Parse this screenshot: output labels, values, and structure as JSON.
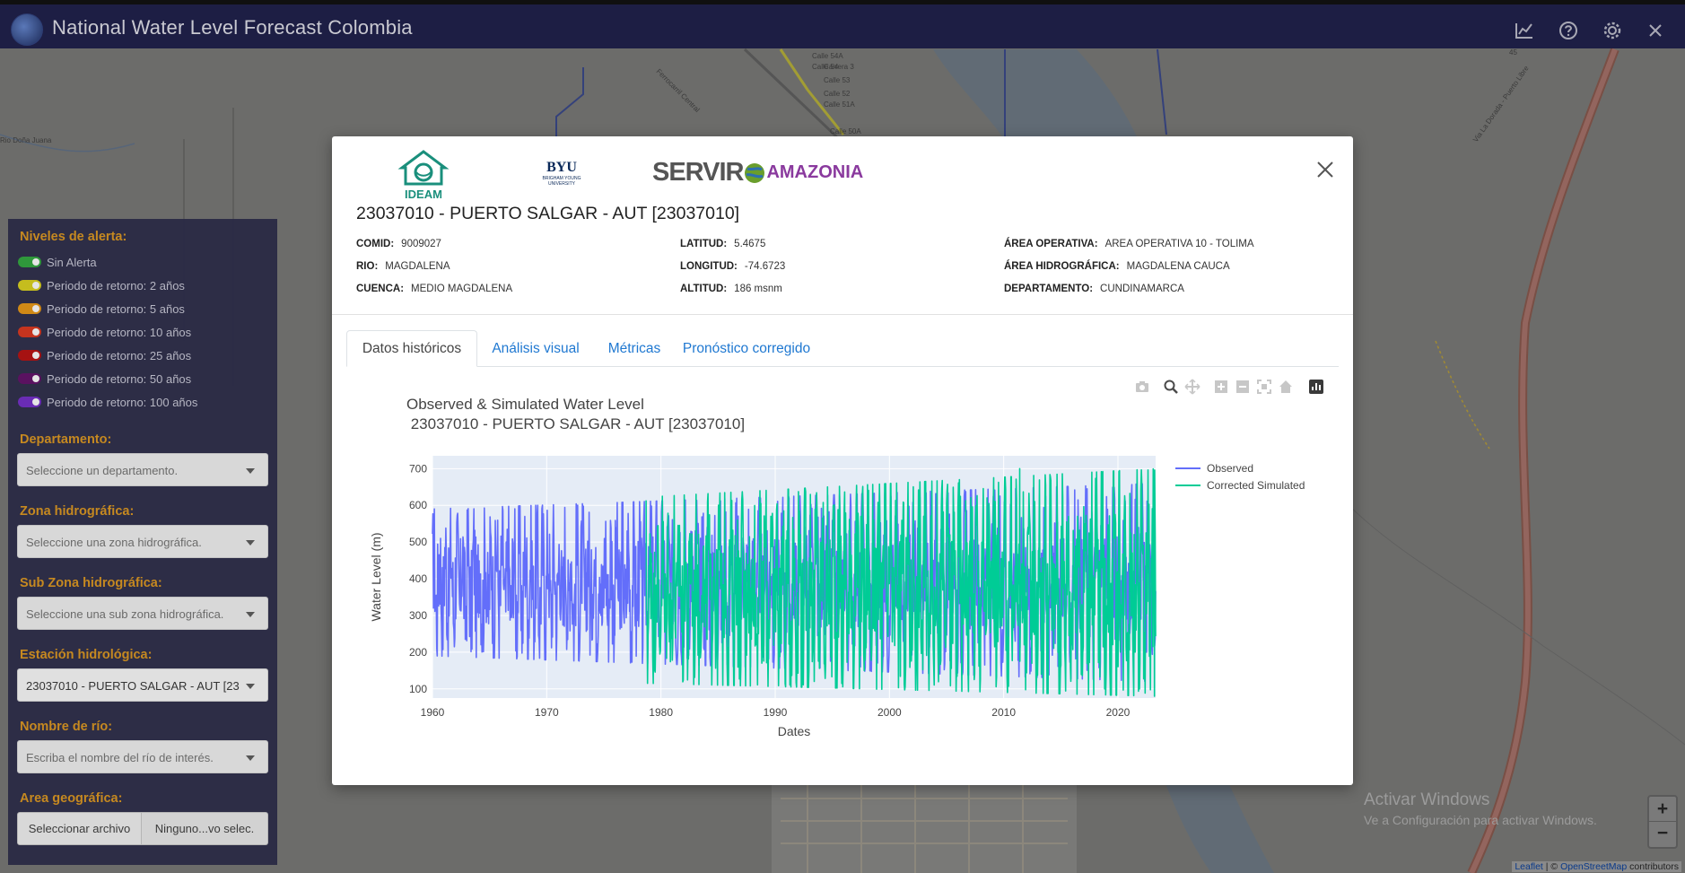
{
  "header": {
    "title": "National Water Level Forecast Colombia",
    "icons": [
      "chart-line-icon",
      "help-icon",
      "gear-icon",
      "close-icon"
    ]
  },
  "sidebar": {
    "alert_heading": "Niveles de alerta:",
    "alert_levels": [
      {
        "label": "Sin Alerta",
        "color": "#2e9a3a"
      },
      {
        "label": "Periodo de retorno: 2 años",
        "color": "#c8c01c"
      },
      {
        "label": "Periodo de retorno: 5 años",
        "color": "#d48a14"
      },
      {
        "label": "Periodo de retorno: 10 años",
        "color": "#c8331c"
      },
      {
        "label": "Periodo de retorno: 25 años",
        "color": "#a81010"
      },
      {
        "label": "Periodo de retorno: 50 años",
        "color": "#5a1060"
      },
      {
        "label": "Periodo de retorno: 100 años",
        "color": "#6a2ab8"
      }
    ],
    "departamento": {
      "heading": "Departamento:",
      "placeholder": "Seleccione un departamento."
    },
    "zona": {
      "heading": "Zona hidrográfica:",
      "placeholder": "Seleccione una zona hidrográfica."
    },
    "subzona": {
      "heading": "Sub Zona hidrográfica:",
      "placeholder": "Seleccione una sub zona hidrográfica."
    },
    "estacion": {
      "heading": "Estación hidrológica:",
      "value": "23037010 - PUERTO SALGAR - AUT [23"
    },
    "rio": {
      "heading": "Nombre de río:",
      "placeholder": "Escriba el nombre del río de interés."
    },
    "area": {
      "heading": "Area geográfica:",
      "file_button": "Seleccionar archivo",
      "file_status": "Ninguno...vo selec."
    }
  },
  "map": {
    "attribution_leaflet": "Leaflet",
    "attribution_rest": " | © ",
    "attribution_osm": "OpenStreetMap",
    "attribution_tail": " contributors",
    "zoom_in": "+",
    "zoom_out": "−",
    "activate_title": "Activar Windows",
    "activate_sub": "Ve a Configuración para activar Windows.",
    "street_labels": [
      "Calle 54A",
      "Calle 54",
      "Calle 53",
      "Calle 52",
      "Calle 51A",
      "Calle 50A",
      "Ferrocarril Central",
      "Rio Doña Juana",
      "Via La Dorada - Puerto Libre",
      "Carrera 3",
      "45"
    ]
  },
  "modal": {
    "logos": {
      "ideam": "IDEAM",
      "byu_main": "BYU",
      "byu_sub": "BRIGHAM YOUNG UNIVERSITY",
      "servir": "SERVIR",
      "amazonia": "AMAZONIA"
    },
    "station_title": "23037010 - PUERTO SALGAR - AUT [23037010]",
    "info": [
      {
        "label": "COMID:",
        "value": "9009027"
      },
      {
        "label": "RIO:",
        "value": "MAGDALENA"
      },
      {
        "label": "CUENCA:",
        "value": "MEDIO MAGDALENA"
      },
      {
        "label": "LATITUD:",
        "value": "5.4675"
      },
      {
        "label": "LONGITUD:",
        "value": "-74.6723"
      },
      {
        "label": "ALTITUD:",
        "value": "186 msnm"
      },
      {
        "label": "ÁREA OPERATIVA:",
        "value": "AREA OPERATIVA 10 - TOLIMA"
      },
      {
        "label": "ÁREA HIDROGRÁFICA:",
        "value": "MAGDALENA CAUCA"
      },
      {
        "label": "DEPARTAMENTO:",
        "value": "CUNDINAMARCA"
      }
    ],
    "tabs": [
      "Datos históricos",
      "Análisis visual",
      "Métricas",
      "Pronóstico corregido"
    ],
    "active_tab": "Datos históricos"
  },
  "chart_data": {
    "type": "line",
    "title": "Observed & Simulated Water Level",
    "subtitle": " 23037010 - PUERTO SALGAR - AUT [23037010]",
    "xlabel": "Dates",
    "ylabel": "Water Level (m)",
    "xlim": [
      1960,
      2023.3
    ],
    "ylim": [
      75,
      735
    ],
    "x_ticks": [
      "1960",
      "1970",
      "1980",
      "1990",
      "2000",
      "2010",
      "2020"
    ],
    "y_ticks": [
      "100",
      "200",
      "300",
      "400",
      "500",
      "600",
      "700"
    ],
    "legend_position": "top-right",
    "grid": true,
    "series": [
      {
        "name": "Observed",
        "color": "#636efa",
        "x_range": [
          1960,
          2023.3
        ],
        "envelope_low": [
          190,
          120
        ],
        "envelope_high": [
          590,
          660
        ],
        "peak": {
          "x": 2017.3,
          "y": 645
        }
      },
      {
        "name": "Corrected Simulated",
        "color": "#00cc96",
        "x_range": [
          1978.7,
          2023.3
        ],
        "envelope_low": [
          130,
          80
        ],
        "envelope_high": [
          590,
          700
        ],
        "peak": {
          "x": 2011.4,
          "y": 700
        },
        "min": {
          "x": 2023.2,
          "y": 80
        }
      }
    ]
  }
}
